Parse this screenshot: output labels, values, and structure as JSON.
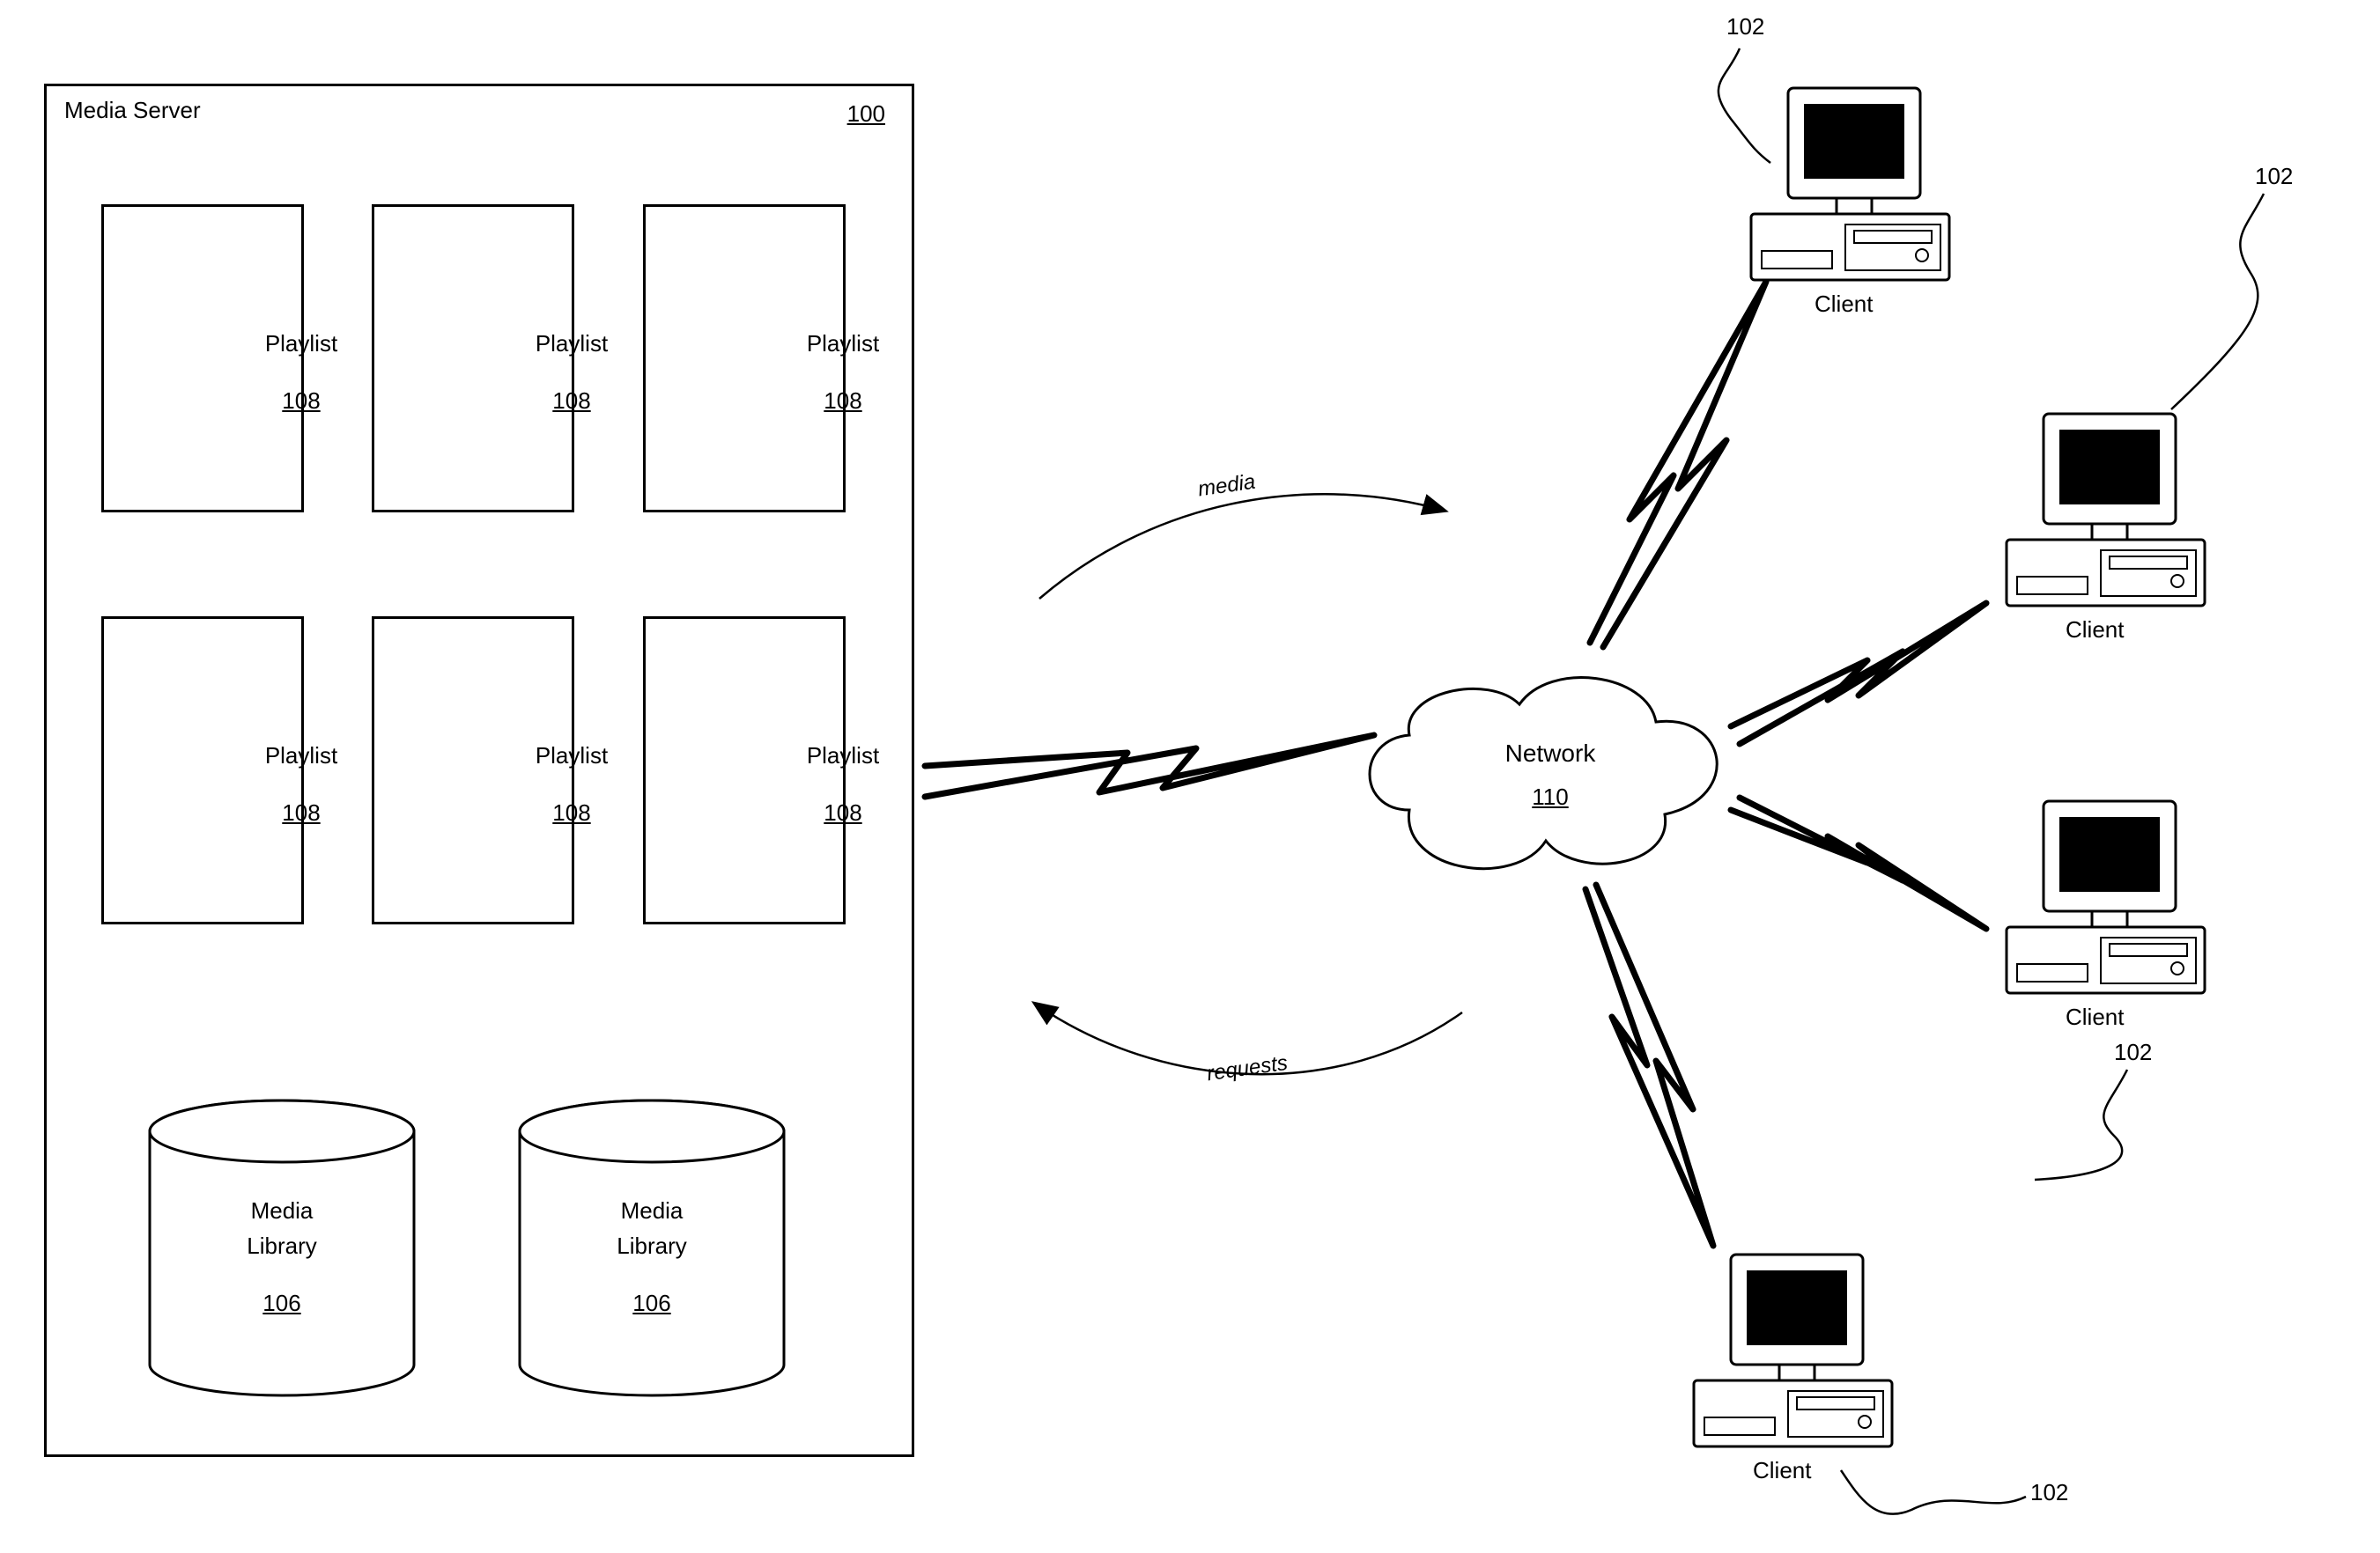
{
  "server": {
    "title": "Media Server",
    "ref": "100",
    "playlist_label": "Playlist",
    "playlist_ref": "108",
    "media_library_l1": "Media",
    "media_library_l2": "Library",
    "media_library_ref": "106"
  },
  "network": {
    "label": "Network",
    "ref": "110"
  },
  "arcs": {
    "media": "media",
    "requests": "requests"
  },
  "client": {
    "label": "Client",
    "ref": "102"
  }
}
